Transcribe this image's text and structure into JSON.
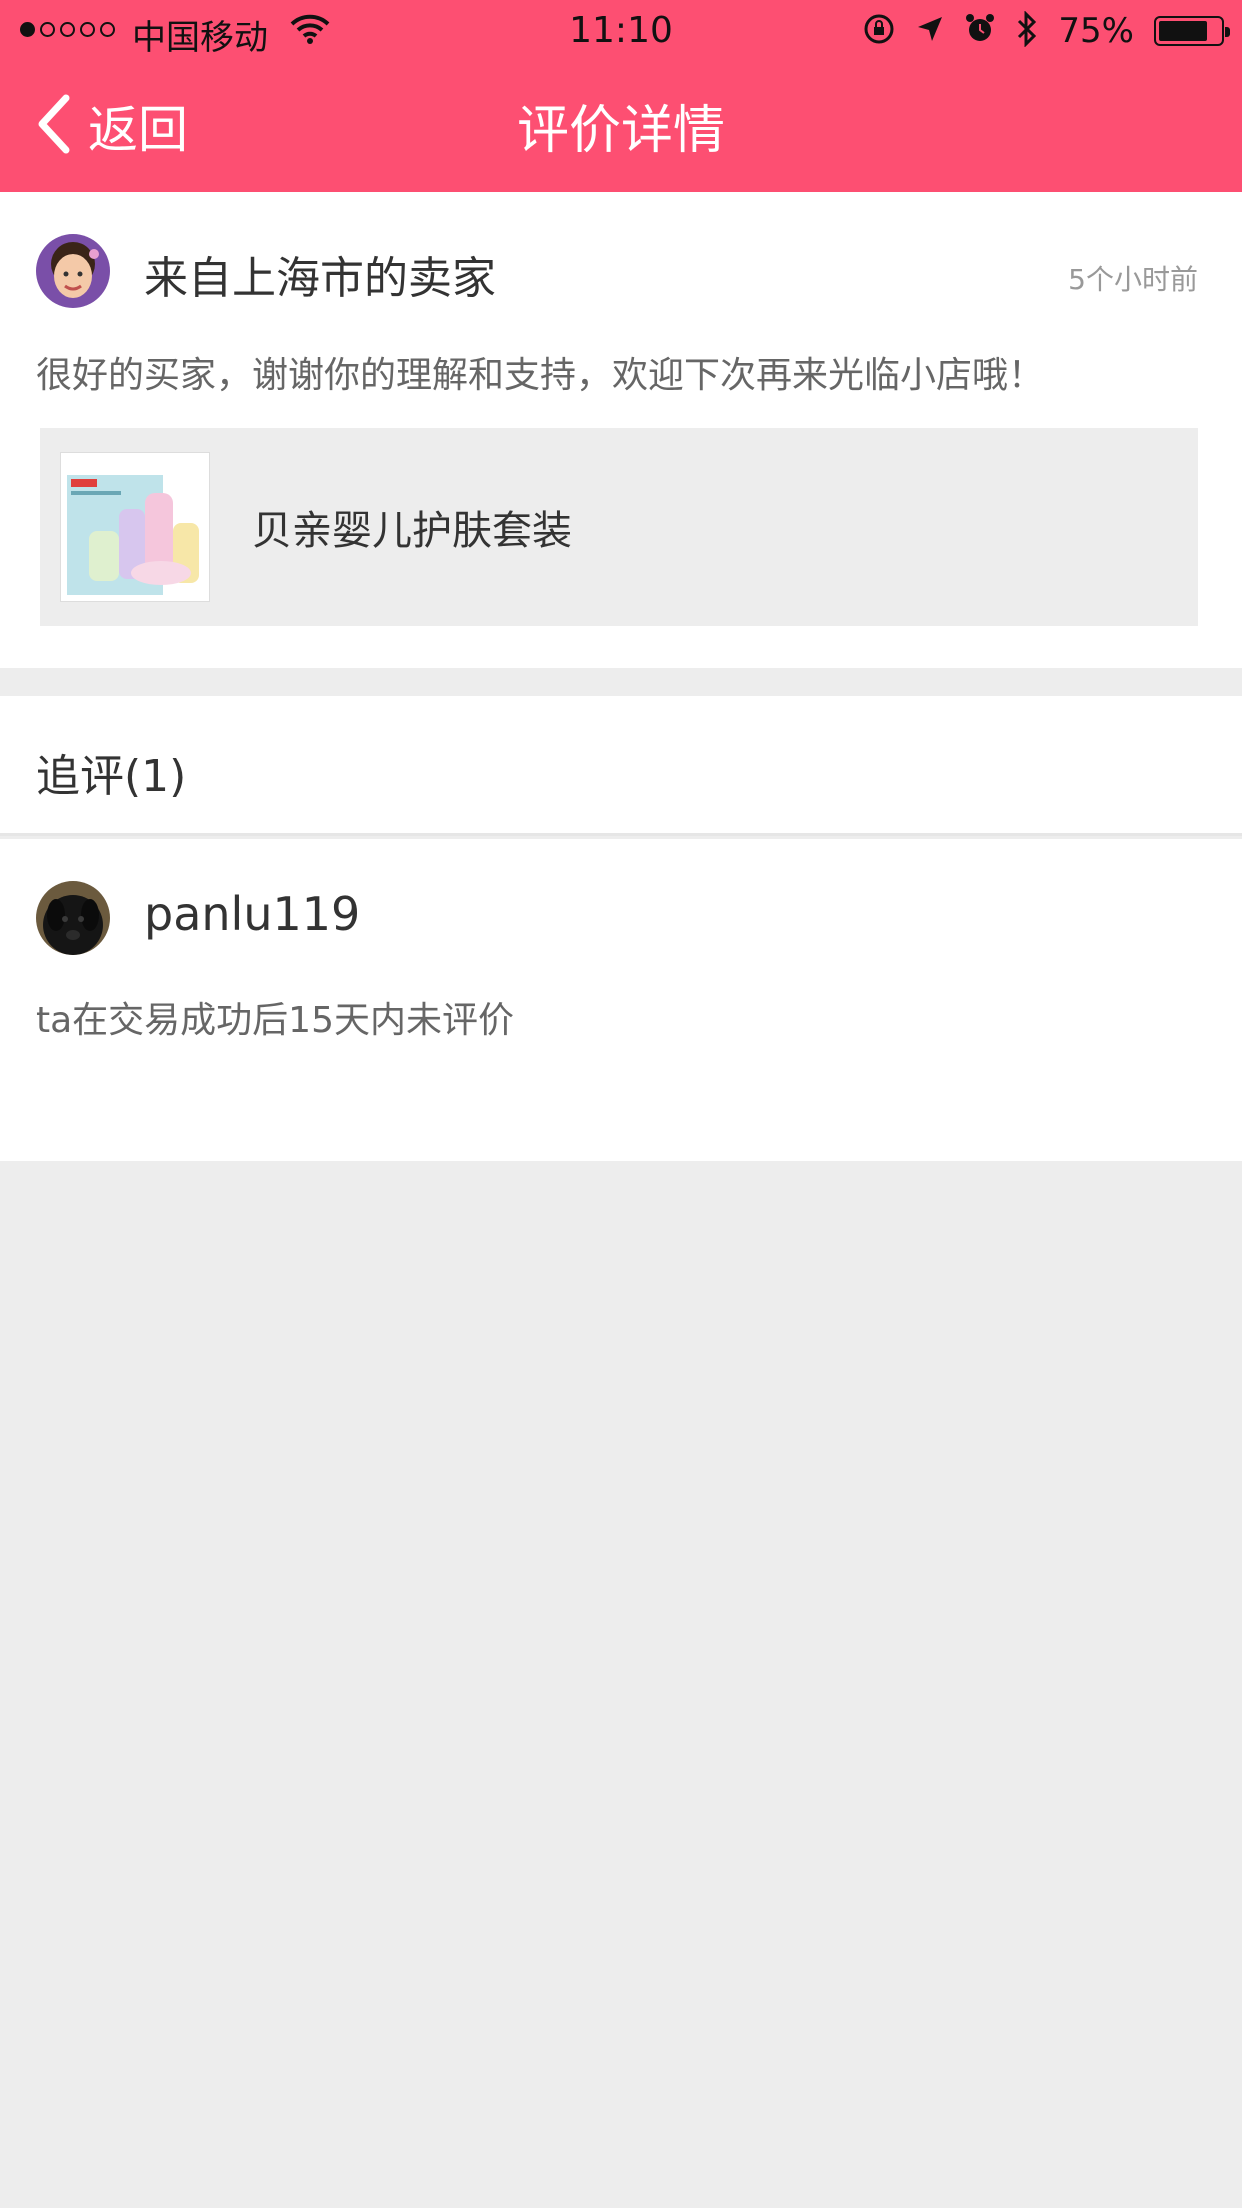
{
  "status_bar": {
    "carrier": "中国移动",
    "time": "11:10",
    "battery_percent": "75%",
    "battery_level": 0.75
  },
  "nav": {
    "back_label": "返回",
    "title": "评价详情"
  },
  "seller_review": {
    "name": "来自上海市的卖家",
    "time_ago": "5个小时前",
    "text": "很好的买家，谢谢你的理解和支持，欢迎下次再来光临小店哦！",
    "product_name": "贝亲婴儿护肤套装"
  },
  "followup": {
    "title": "追评(1)",
    "items": [
      {
        "username": "panlu119",
        "note": "ta在交易成功后15天内未评价"
      }
    ]
  },
  "colors": {
    "header": "#fd4f72",
    "background": "#ededed"
  }
}
